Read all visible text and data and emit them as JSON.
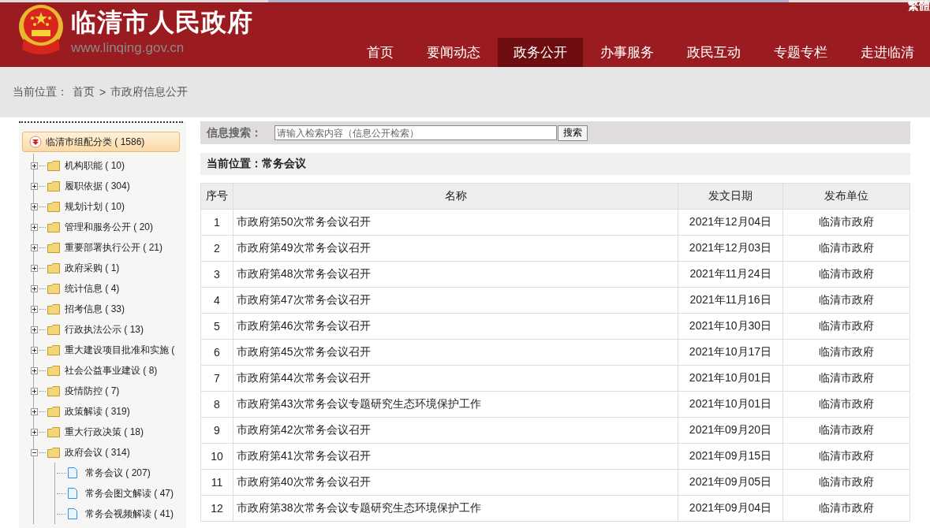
{
  "header": {
    "site_title": "临清市人民政府",
    "site_url": "www.linqing.gov.cn",
    "lang_link": "繁體"
  },
  "nav": [
    {
      "label": "首页",
      "selected": false
    },
    {
      "label": "要闻动态",
      "selected": false
    },
    {
      "label": "政务公开",
      "selected": true
    },
    {
      "label": "办事服务",
      "selected": false
    },
    {
      "label": "政民互动",
      "selected": false
    },
    {
      "label": "专题专栏",
      "selected": false
    },
    {
      "label": "走进临清",
      "selected": false
    }
  ],
  "breadcrumb": {
    "label": "当前位置：",
    "items": [
      "首页",
      "市政府信息公开"
    ],
    "separator": ">"
  },
  "sidebar": {
    "root": {
      "label": "临清市组配分类 ( 1586)",
      "expanded": true
    },
    "items": [
      {
        "label": "机构职能 ( 10)",
        "expanded": false
      },
      {
        "label": "履职依据 ( 304)",
        "expanded": false
      },
      {
        "label": "规划计划 ( 10)",
        "expanded": false
      },
      {
        "label": "管理和服务公开 ( 20)",
        "expanded": false
      },
      {
        "label": "重要部署执行公开 ( 21)",
        "expanded": false
      },
      {
        "label": "政府采购 ( 1)",
        "expanded": false
      },
      {
        "label": "统计信息 ( 4)",
        "expanded": false
      },
      {
        "label": "招考信息 ( 33)",
        "expanded": false
      },
      {
        "label": "行政执法公示 ( 13)",
        "expanded": false
      },
      {
        "label": "重大建设项目批准和实施 (",
        "expanded": false
      },
      {
        "label": "社会公益事业建设 ( 8)",
        "expanded": false
      },
      {
        "label": "疫情防控 ( 7)",
        "expanded": false
      },
      {
        "label": "政策解读 ( 319)",
        "expanded": false
      },
      {
        "label": "重大行政决策 ( 18)",
        "expanded": false
      },
      {
        "label": "政府会议 ( 314)",
        "expanded": true,
        "children": [
          {
            "label": "常务会议 ( 207)"
          },
          {
            "label": "常务会图文解读 ( 47)"
          },
          {
            "label": "常务会视频解读 ( 41)"
          }
        ]
      }
    ]
  },
  "search": {
    "label": "信息搜索：",
    "placeholder": "请输入检索内容（信息公开检索）",
    "button": "搜索"
  },
  "location": "当前位置：常务会议",
  "table": {
    "columns": [
      "序号",
      "名称",
      "发文日期",
      "发布单位"
    ],
    "rows": [
      [
        "1",
        "市政府第50次常务会议召开",
        "2021年12月04日",
        "临清市政府"
      ],
      [
        "2",
        "市政府第49次常务会议召开",
        "2021年12月03日",
        "临清市政府"
      ],
      [
        "3",
        "市政府第48次常务会议召开",
        "2021年11月24日",
        "临清市政府"
      ],
      [
        "4",
        "市政府第47次常务会议召开",
        "2021年11月16日",
        "临清市政府"
      ],
      [
        "5",
        "市政府第46次常务会议召开",
        "2021年10月30日",
        "临清市政府"
      ],
      [
        "6",
        "市政府第45次常务会议召开",
        "2021年10月17日",
        "临清市政府"
      ],
      [
        "7",
        "市政府第44次常务会议召开",
        "2021年10月01日",
        "临清市政府"
      ],
      [
        "8",
        "市政府第43次常务会议专题研究生态环境保护工作",
        "2021年10月01日",
        "临清市政府"
      ],
      [
        "9",
        "市政府第42次常务会议召开",
        "2021年09月20日",
        "临清市政府"
      ],
      [
        "10",
        "市政府第41次常务会议召开",
        "2021年09月15日",
        "临清市政府"
      ],
      [
        "11",
        "市政府第40次常务会议召开",
        "2021年09月05日",
        "临清市政府"
      ],
      [
        "12",
        "市政府第38次常务会议专题研究生态环境保护工作",
        "2021年09月04日",
        "临清市政府"
      ]
    ]
  }
}
